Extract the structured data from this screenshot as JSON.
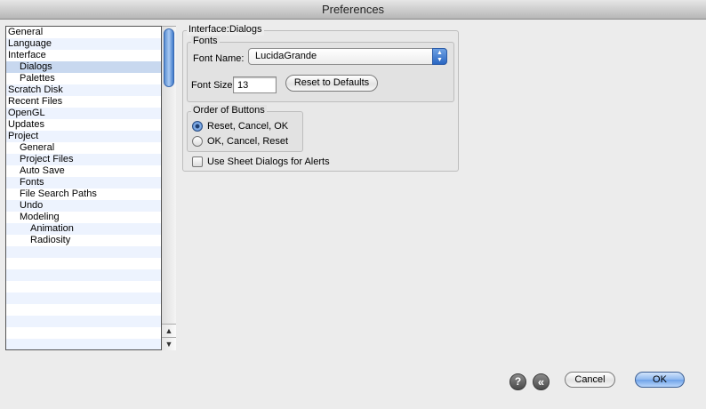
{
  "window": {
    "title": "Preferences"
  },
  "tree": {
    "items": [
      {
        "label": "General",
        "level": 0
      },
      {
        "label": "Language",
        "level": 0
      },
      {
        "label": "Interface",
        "level": 0
      },
      {
        "label": "Dialogs",
        "level": 1,
        "selected": true
      },
      {
        "label": "Palettes",
        "level": 1
      },
      {
        "label": "Scratch Disk",
        "level": 0
      },
      {
        "label": "Recent Files",
        "level": 0
      },
      {
        "label": "OpenGL",
        "level": 0
      },
      {
        "label": "Updates",
        "level": 0
      },
      {
        "label": "Project",
        "level": 0
      },
      {
        "label": "General",
        "level": 1
      },
      {
        "label": "Project Files",
        "level": 1
      },
      {
        "label": "Auto Save",
        "level": 1
      },
      {
        "label": "Fonts",
        "level": 1
      },
      {
        "label": "File Search Paths",
        "level": 1
      },
      {
        "label": "Undo",
        "level": 1
      },
      {
        "label": "Modeling",
        "level": 1
      },
      {
        "label": "Animation",
        "level": 2
      },
      {
        "label": "Radiosity",
        "level": 2
      }
    ],
    "scroll_up_icon": "up-arrow-icon",
    "scroll_down_icon": "down-arrow-icon"
  },
  "panel": {
    "title": "Interface:Dialogs",
    "fonts_group": {
      "label": "Fonts",
      "font_name_label": "Font Name:",
      "font_name_value": "LucidaGrande",
      "font_size_label": "Font Size",
      "font_size_value": "13",
      "reset_button": "Reset to Defaults"
    },
    "order_group": {
      "label": "Order of Buttons",
      "options": [
        "Reset, Cancel, OK",
        "OK, Cancel, Reset"
      ],
      "selected_index": 0
    },
    "sheet_checkbox_label": "Use Sheet Dialogs for Alerts",
    "sheet_checkbox_checked": false
  },
  "footer": {
    "help_icon": "?",
    "back_icon": "«",
    "cancel_button": "Cancel",
    "ok_button": "OK"
  }
}
